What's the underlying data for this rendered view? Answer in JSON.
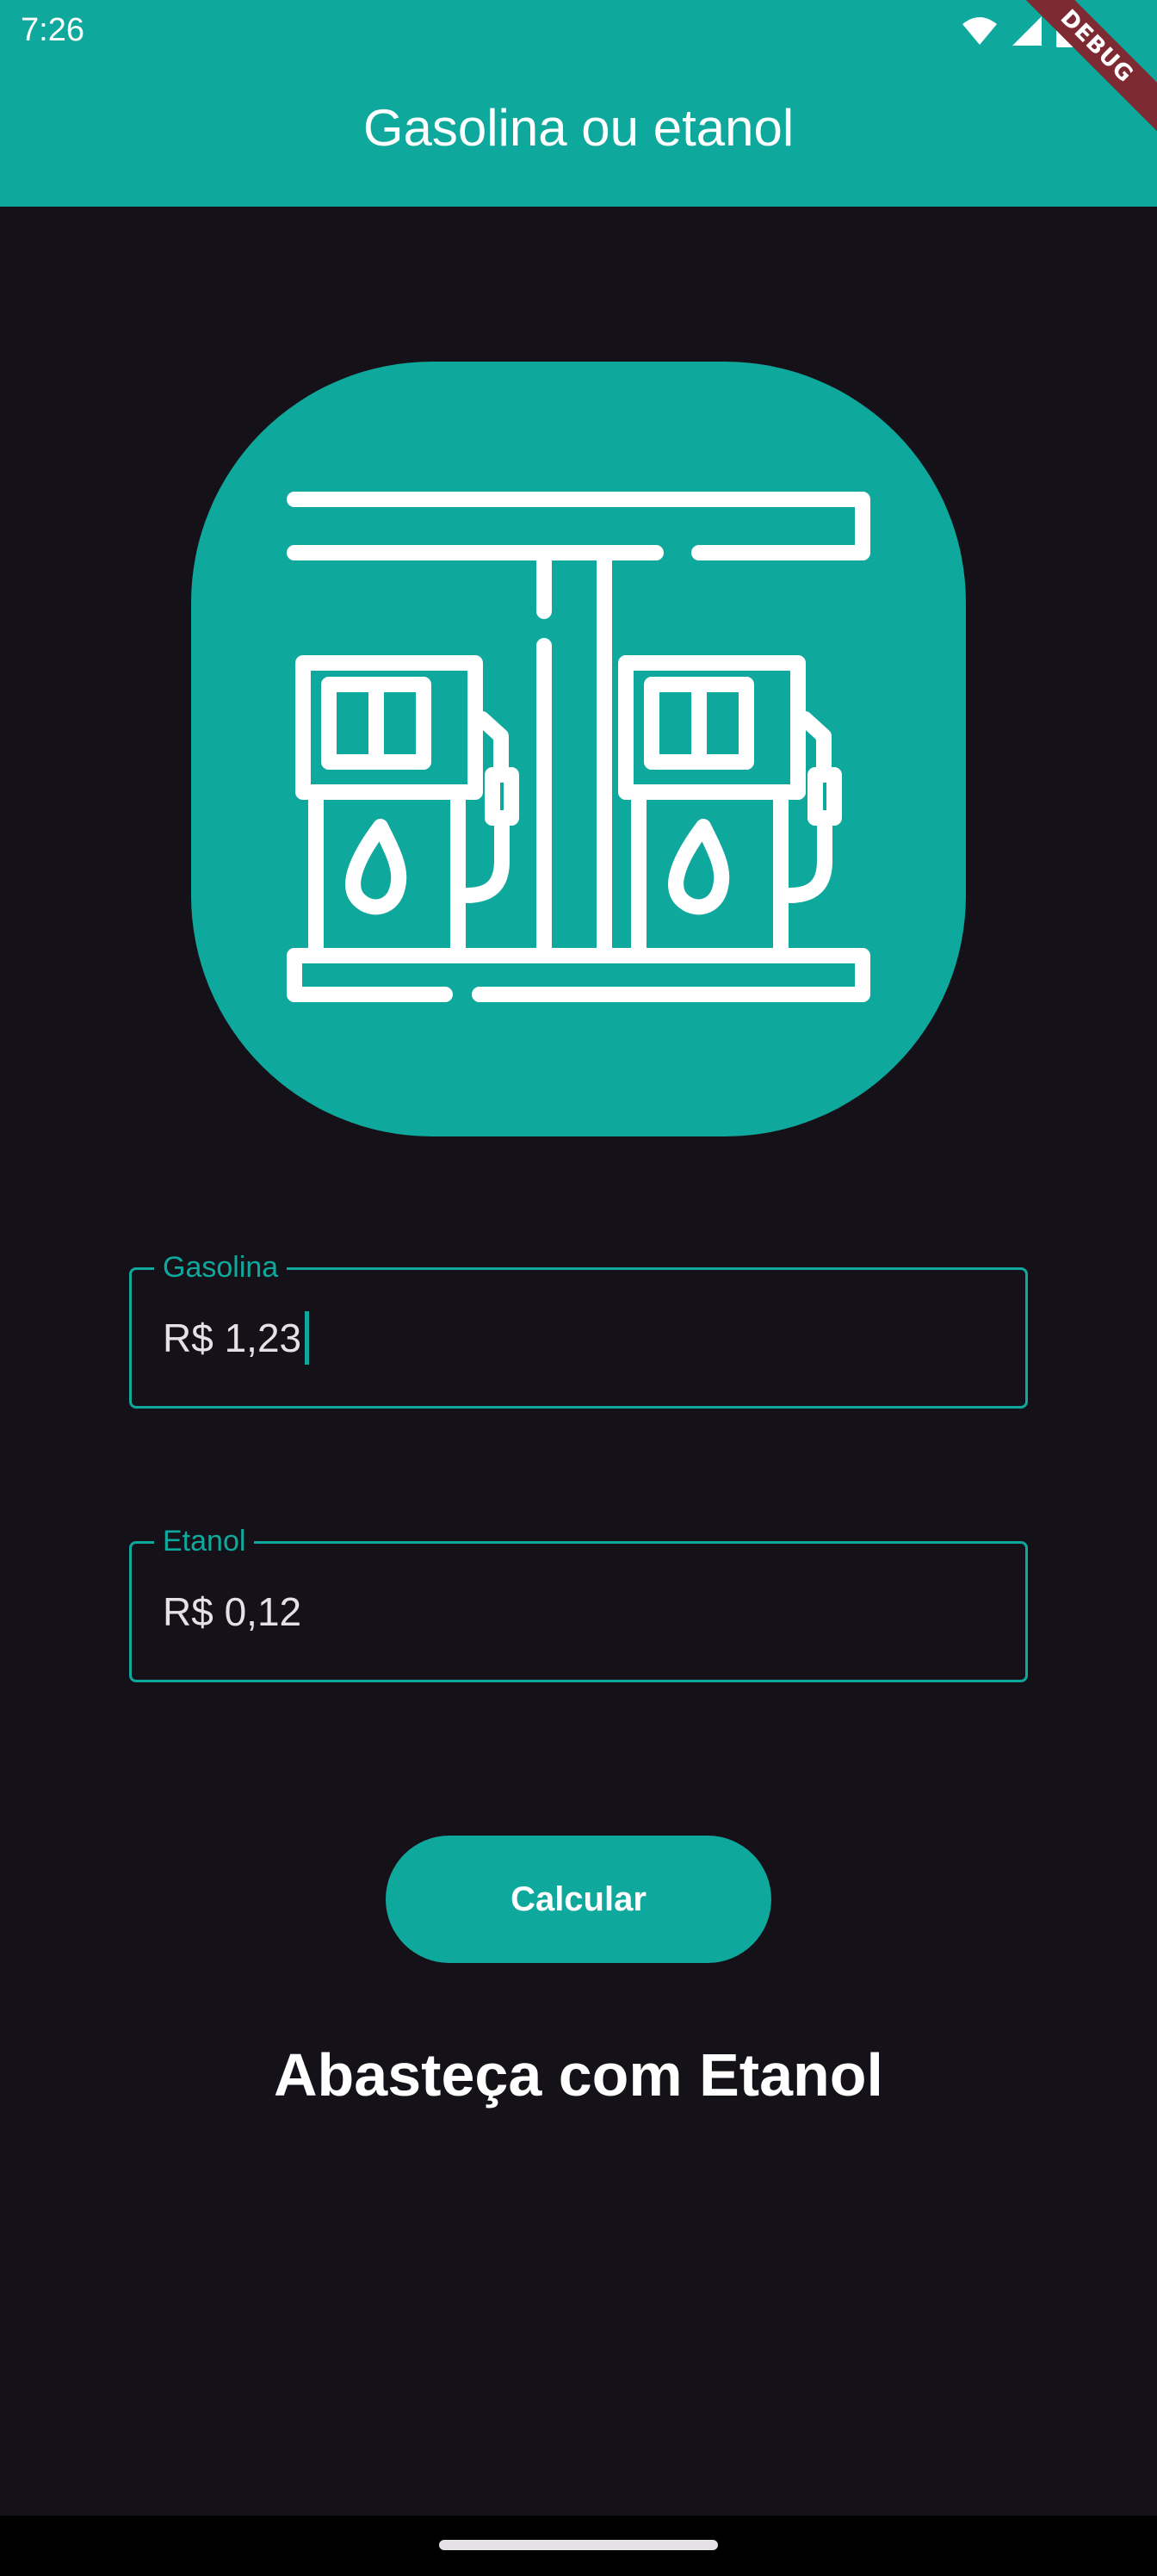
{
  "status_bar": {
    "time": "7:26"
  },
  "app_bar": {
    "title": "Gasolina ou etanol"
  },
  "debug_banner": "DEBUG",
  "logo": {
    "icon": "gas-station-icon"
  },
  "form": {
    "gasolina": {
      "label": "Gasolina",
      "value": "R$ 1,23"
    },
    "etanol": {
      "label": "Etanol",
      "value": "R$ 0,12"
    }
  },
  "actions": {
    "calculate_label": "Calcular"
  },
  "result": {
    "text": "Abasteça com Etanol"
  },
  "colors": {
    "primary": "#0fa89d",
    "background": "#141218",
    "on_primary": "#ffffff"
  }
}
